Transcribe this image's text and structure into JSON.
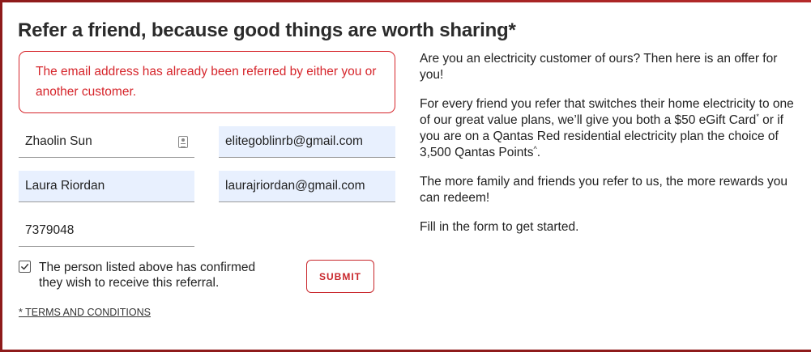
{
  "title": "Refer a friend, because good things are worth sharing*",
  "error": {
    "message": "The email address has already been referred by either you or another customer."
  },
  "form": {
    "referrer_name": "Zhaolin Sun",
    "referrer_email": "elitegoblinrb@gmail.com",
    "friend_name": "Laura Riordan",
    "friend_email": "laurajriordan@gmail.com",
    "account_number": "7379048",
    "consent_checked": true,
    "consent_label": "The person listed above has confirmed they wish to receive this referral.",
    "submit_label": "SUBMIT",
    "terms_link": "* TERMS AND CONDITIONS"
  },
  "info": {
    "p1": "Are you an electricity customer of ours? Then here is an offer for you!",
    "p2_a": "For every friend you refer that switches their home electricity to one of our great value plans, we’ll give you both a $50 eGift Card",
    "p2_sup1": "*",
    "p2_b": " or if you are on a Qantas Red residential electricity plan the choice of 3,500 Qantas Points",
    "p2_sup2": "^",
    "p2_c": ".",
    "p3": "The more family and friends you refer to us, the more rewards you can redeem!",
    "p4": "Fill in the form to get started."
  },
  "colors": {
    "accent": "#d6252b",
    "autofill": "#e8f0fe",
    "frame": "#8e1b1b"
  },
  "icons": {
    "contact_card": "contact-card-icon",
    "check": "check-icon"
  }
}
